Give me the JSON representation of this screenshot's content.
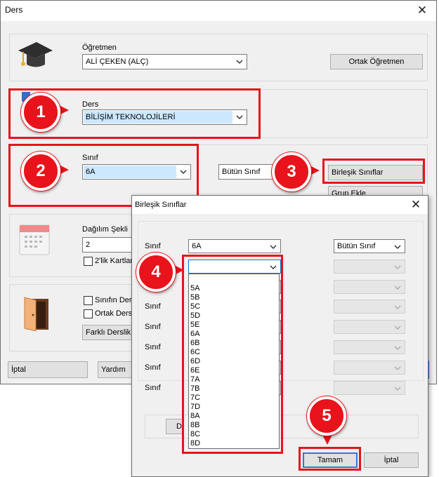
{
  "main_window": {
    "title": "Ders",
    "teacher": {
      "label": "Öğretmen",
      "value": "ALİ ÇEKEN (ALÇ)",
      "button": "Ortak Öğretmen"
    },
    "course": {
      "label": "Ders",
      "value": "BİLİŞİM TEKNOLOJİLERİ"
    },
    "class": {
      "label": "Sınıf",
      "value": "6A",
      "all_classes": "Bütün Sınıf",
      "combined_button": "Birleşik Sınıflar",
      "group_button": "Grup Ekle"
    },
    "distribution": {
      "label": "Dağılım Şekli",
      "value": "2",
      "double_cards": "2'lik Kartlar"
    },
    "room": {
      "class_room": "Sınıfın Dersl",
      "common_room": "Ortak Dersl",
      "other_room_button": "Farklı Derslik S"
    },
    "footer": {
      "cancel": "İptal",
      "help": "Yardım"
    }
  },
  "dialog": {
    "title": "Birleşik Sınıflar",
    "row_label": "Sınıf",
    "rows": [
      {
        "class": "6A",
        "scope": "Bütün Sınıf"
      },
      {
        "class": "",
        "scope": ""
      },
      {
        "class": "",
        "scope": ""
      },
      {
        "class": "",
        "scope": ""
      },
      {
        "class": "",
        "scope": ""
      },
      {
        "class": "",
        "scope": ""
      },
      {
        "class": "",
        "scope": ""
      },
      {
        "class": "",
        "scope": ""
      }
    ],
    "dropdown_options": [
      "5A",
      "5B",
      "5C",
      "5D",
      "5E",
      "6A",
      "6B",
      "6C",
      "6D",
      "6E",
      "7A",
      "7B",
      "7C",
      "7D",
      "8A",
      "8B",
      "8C",
      "8D"
    ],
    "hidden_button_fragment": "D",
    "ok": "Tamam",
    "cancel": "İptal"
  },
  "callouts": [
    "1",
    "2",
    "3",
    "4",
    "5"
  ],
  "colors": {
    "annotation_red": "#e8131b",
    "selection_blue": "#cce8ff",
    "window_bg": "#f0f0f0"
  }
}
